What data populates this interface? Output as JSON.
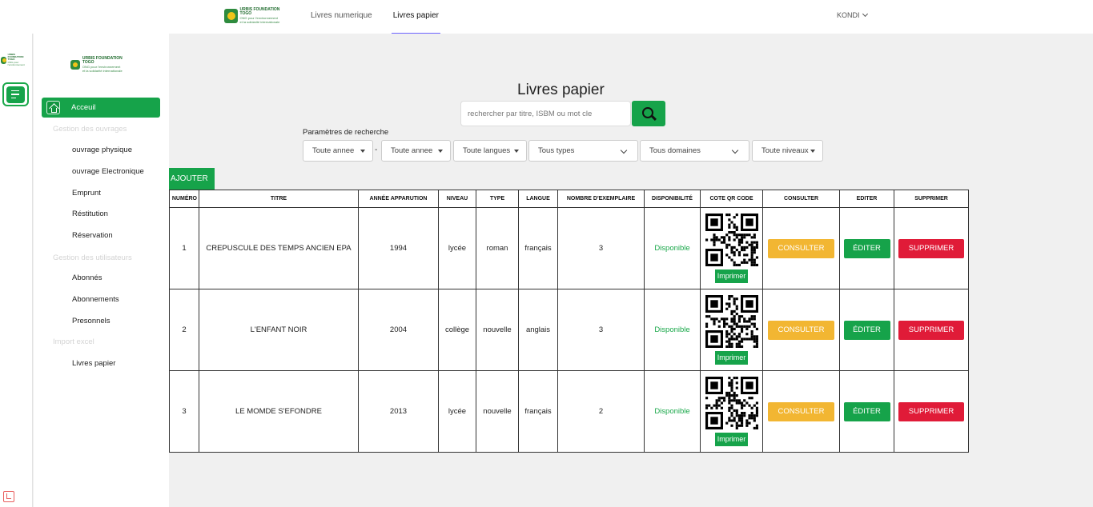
{
  "brand": {
    "name": "URBIS FOUNDATION TOGO",
    "tagline": "ONG pour l'environnement",
    "tagline2": "et la solidarité internationale"
  },
  "topnav": {
    "items": [
      {
        "label": "Livres numerique",
        "active": false
      },
      {
        "label": "Livres papier",
        "active": true
      }
    ],
    "user": "KONDI"
  },
  "sidebar": {
    "home_label": "Acceuil",
    "sections": [
      {
        "heading": "Gestion des ouvrages",
        "items": [
          "ouvrage physique",
          "ouvrage Electronique",
          "Emprunt",
          "Réstitution",
          "Réservation"
        ]
      },
      {
        "heading": "Gestion des utilisateurs",
        "items": [
          "Abonnés",
          "Abonnements",
          "Presonnels"
        ]
      },
      {
        "heading": "Import excel",
        "items": [
          "Livres papier"
        ]
      }
    ]
  },
  "page": {
    "title": "Livres papier",
    "search_placeholder": "rechercher par titre, ISBM ou mot cle",
    "params_label": "Paramètres de recherche",
    "filters": {
      "year_from": "Toute annee",
      "separator": "-",
      "year_to": "Toute annee",
      "language": "Toute langues",
      "types": "Tous types",
      "domains": "Tous domaines",
      "levels": "Toute niveaux"
    },
    "add_label": "AJOUTER"
  },
  "table": {
    "headers": [
      "NUMÉRO",
      "TITRE",
      "ANNÉE APPARUTION",
      "NIVEAU",
      "TYPE",
      "LANGUE",
      "NOMBRE D'EXEMPLAIRE",
      "DISPONIBILITÉ",
      "COTE QR CODE",
      "CONSULTER",
      "EDITER",
      "SUPPRIMER"
    ],
    "rows": [
      {
        "num": "1",
        "title": "CREPUSCULE DES TEMPS ANCIEN EPA",
        "year": "1994",
        "level": "lycée",
        "type": "roman",
        "lang": "français",
        "copies": "3",
        "status": "Disponible"
      },
      {
        "num": "2",
        "title": "L'ENFANT NOIR",
        "year": "2004",
        "level": "collège",
        "type": "nouvelle",
        "lang": "anglais",
        "copies": "3",
        "status": "Disponible"
      },
      {
        "num": "3",
        "title": "LE MOMDE S'EFONDRE",
        "year": "2013",
        "level": "lycée",
        "type": "nouvelle",
        "lang": "français",
        "copies": "2",
        "status": "Disponible"
      }
    ],
    "print_label": "Imprimer",
    "consult_label": "CONSULTER",
    "edit_label": "ÉDITER",
    "delete_label": "SUPPRIMER"
  },
  "colors": {
    "primary": "#16a34a",
    "warning": "#f2b632",
    "danger": "#e01b38",
    "background": "#f0f0f0"
  },
  "icons": [
    "menu-icon",
    "home-icon",
    "search-icon",
    "chevron-down-icon",
    "qr-code-icon",
    "laravel-icon"
  ]
}
